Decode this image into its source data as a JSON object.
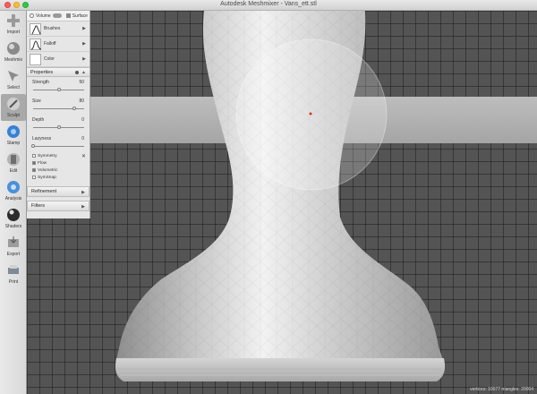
{
  "window": {
    "title": "Autodesk Meshmixer - Vans_ett.stl"
  },
  "toolbar": {
    "items": [
      {
        "label": "Import",
        "icon": "plus-icon"
      },
      {
        "label": "Meshmix",
        "icon": "sphere-icon"
      },
      {
        "label": "Select",
        "icon": "arrow-cursor-icon"
      },
      {
        "label": "Sculpt",
        "icon": "brush-icon",
        "active": true
      },
      {
        "label": "Stamp",
        "icon": "stamp-icon"
      },
      {
        "label": "Edit",
        "icon": "edit-icon"
      },
      {
        "label": "Analysis",
        "icon": "analysis-icon"
      },
      {
        "label": "Shaders",
        "icon": "shader-sphere-icon"
      },
      {
        "label": "Export",
        "icon": "export-icon"
      },
      {
        "label": "Print",
        "icon": "print-icon"
      }
    ]
  },
  "panel": {
    "mode": {
      "volume": "Volume",
      "surface": "Surface"
    },
    "brushes_label": "Brushes",
    "falloff_label": "Falloff",
    "color_label": "Color",
    "properties_label": "Properties",
    "sliders": [
      {
        "label": "Strength",
        "value": "50",
        "fraction": 0.5
      },
      {
        "label": "Size",
        "value": "80",
        "fraction": 0.8
      },
      {
        "label": "Depth",
        "value": "0",
        "fraction": 0.5
      },
      {
        "label": "Lazyness",
        "value": "0",
        "fraction": 0.0
      }
    ],
    "checks": [
      {
        "label": "Symmetry",
        "on": false
      },
      {
        "label": "Flow",
        "on": true
      },
      {
        "label": "Volumetric",
        "on": true
      },
      {
        "label": "SymSnap",
        "on": false
      }
    ],
    "refinement_label": "Refinement",
    "filters_label": "Filters"
  },
  "status": {
    "text": "vertices: 10077 triangles: 20004"
  },
  "colors": {
    "panel_bg": "#e6e6e6",
    "grid_bg": "#545454",
    "model": "#d8d8d8",
    "brush_dot": "#e0302b"
  }
}
